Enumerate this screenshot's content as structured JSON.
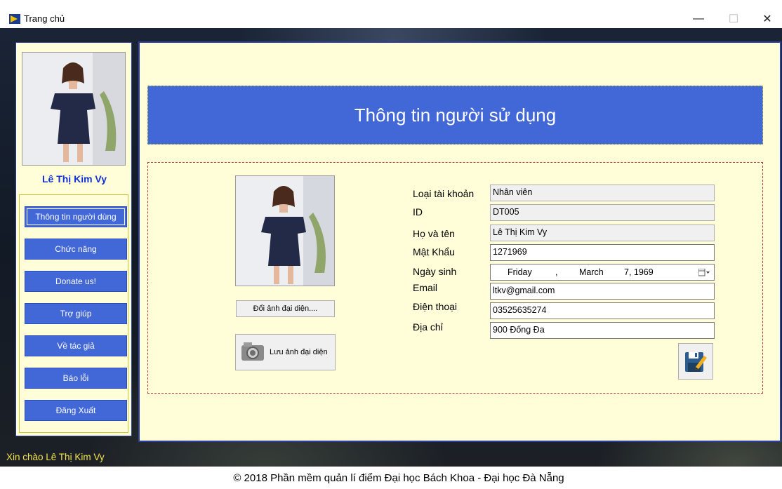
{
  "window": {
    "title": "Trang chủ",
    "minimize_label": "—",
    "maximize_label": "☐",
    "close_label": "✕"
  },
  "sidebar": {
    "username": "Lê Thị Kim Vy",
    "menu": [
      {
        "label": "Thông tin người dùng",
        "active": true
      },
      {
        "label": "Chức năng"
      },
      {
        "label": "Donate us!"
      },
      {
        "label": "Trợ giúp"
      },
      {
        "label": "Về tác giả"
      },
      {
        "label": "Báo lỗi"
      },
      {
        "label": "Đăng Xuất"
      }
    ]
  },
  "main": {
    "title": "Thông tin người sử dụng",
    "change_avatar_label": "Đổi ảnh đại diện....",
    "save_avatar_label": "Lưu ảnh đại diện",
    "fields": {
      "account_type": {
        "label": "Loại tài khoản",
        "value": "Nhân viên"
      },
      "id": {
        "label": "ID",
        "value": "DT005"
      },
      "full_name": {
        "label": "Họ và tên",
        "value": "Lê Thị Kim Vy"
      },
      "password": {
        "label": "Mật Khẩu",
        "value": "1271969"
      },
      "birthday": {
        "label": "Ngày sinh",
        "weekday": "Friday",
        "sep": ",",
        "month": "March",
        "day_year": "7, 1969"
      },
      "email": {
        "label": "Email",
        "value": "ltkv@gmail.com"
      },
      "phone": {
        "label": "Điện thoại",
        "value": "03525635274"
      },
      "address": {
        "label": "Địa chỉ",
        "value": "900 Đống Đa"
      }
    }
  },
  "status": {
    "greeting": "Xin chào Lê Thị Kim Vy",
    "footer": "© 2018 Phần mềm quản lí điểm Đại học Bách Khoa - Đại học Đà Nẵng"
  },
  "colors": {
    "accent_blue": "#4267d7",
    "panel_bg": "#fffed9",
    "greeting_yellow": "#f1e54a"
  }
}
